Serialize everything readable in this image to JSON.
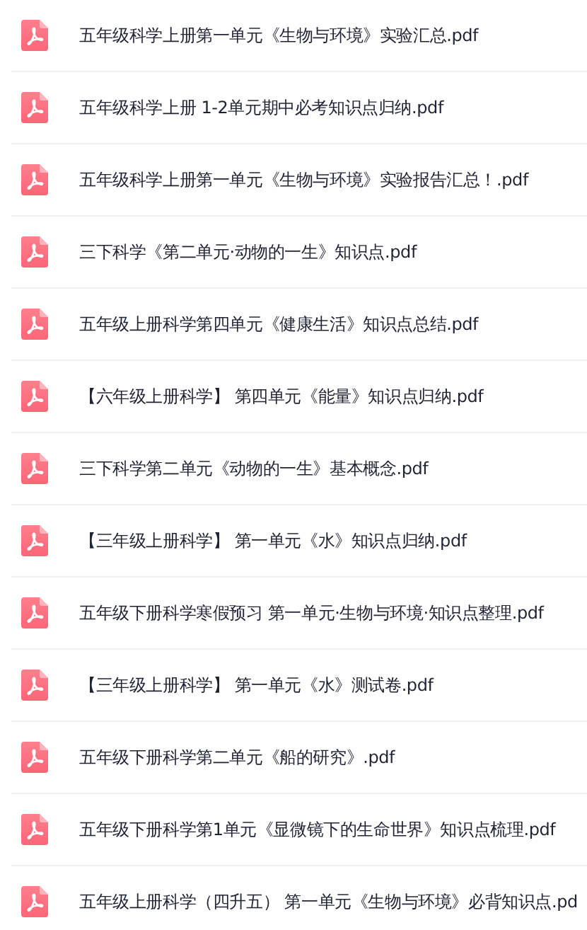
{
  "files": [
    {
      "name": "五年级科学上册第一单元《生物与环境》实验汇总.pdf"
    },
    {
      "name": "五年级科学上册 1-2单元期中必考知识点归纳.pdf"
    },
    {
      "name": "五年级科学上册第一单元《生物与环境》实验报告汇总！.pdf"
    },
    {
      "name": "三下科学《第二单元·动物的一生》知识点.pdf"
    },
    {
      "name": "五年级上册科学第四单元《健康生活》知识点总结.pdf"
    },
    {
      "name": "【六年级上册科学】 第四单元《能量》知识点归纳.pdf"
    },
    {
      "name": "三下科学第二单元《动物的一生》基本概念.pdf"
    },
    {
      "name": "【三年级上册科学】 第一单元《水》知识点归纳.pdf"
    },
    {
      "name": "五年级下册科学寒假预习 第一单元·生物与环境·知识点整理.pdf"
    },
    {
      "name": "【三年级上册科学】 第一单元《水》测试卷.pdf"
    },
    {
      "name": "五年级下册科学第二单元《船的研究》.pdf"
    },
    {
      "name": "五年级下册科学第1单元《显微镜下的生命世界》知识点梳理.pdf"
    },
    {
      "name": "五年级上册科学（四升五） 第一单元《生物与环境》必背知识点.pd"
    }
  ]
}
